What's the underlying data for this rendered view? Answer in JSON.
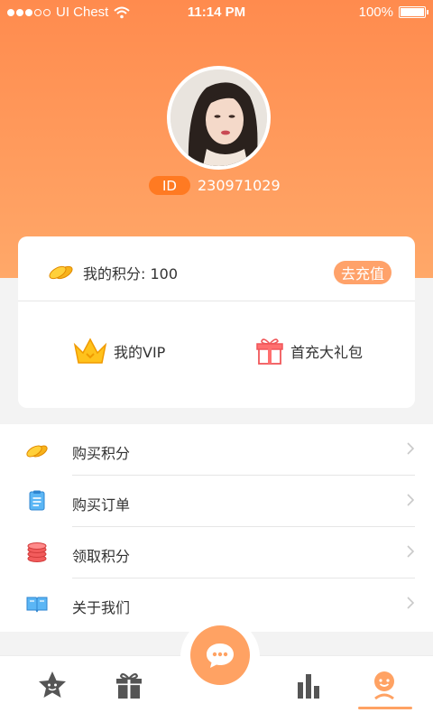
{
  "status_bar": {
    "carrier": "UI Chest",
    "time": "11:14 PM",
    "battery": "100%",
    "signal_dots_filled": 3,
    "signal_dots_total": 5,
    "battery_level": 1.0
  },
  "profile": {
    "id_label": "ID",
    "id_value": "230971029"
  },
  "card": {
    "points_label": "我的积分: 100",
    "recharge_label": "去充值",
    "vip_label": "我的VIP",
    "gift_label": "首充大礼包"
  },
  "menu": {
    "items": [
      {
        "label": "购买积分",
        "icon": "coins-icon"
      },
      {
        "label": "购买订单",
        "icon": "order-list-icon"
      },
      {
        "label": "领取积分",
        "icon": "coin-stack-icon"
      },
      {
        "label": "关于我们",
        "icon": "book-icon"
      }
    ]
  },
  "tabbar": {
    "tabs": [
      "star-face-icon",
      "gift-icon",
      "chat-bubble-icon",
      "bar-chart-icon",
      "profile-icon"
    ],
    "active_tab": "profile-icon"
  },
  "colors": {
    "accent": "#ffa263",
    "header_top": "#ff8b4e",
    "header_bottom": "#ffa869",
    "tab_icon": "#555555"
  }
}
